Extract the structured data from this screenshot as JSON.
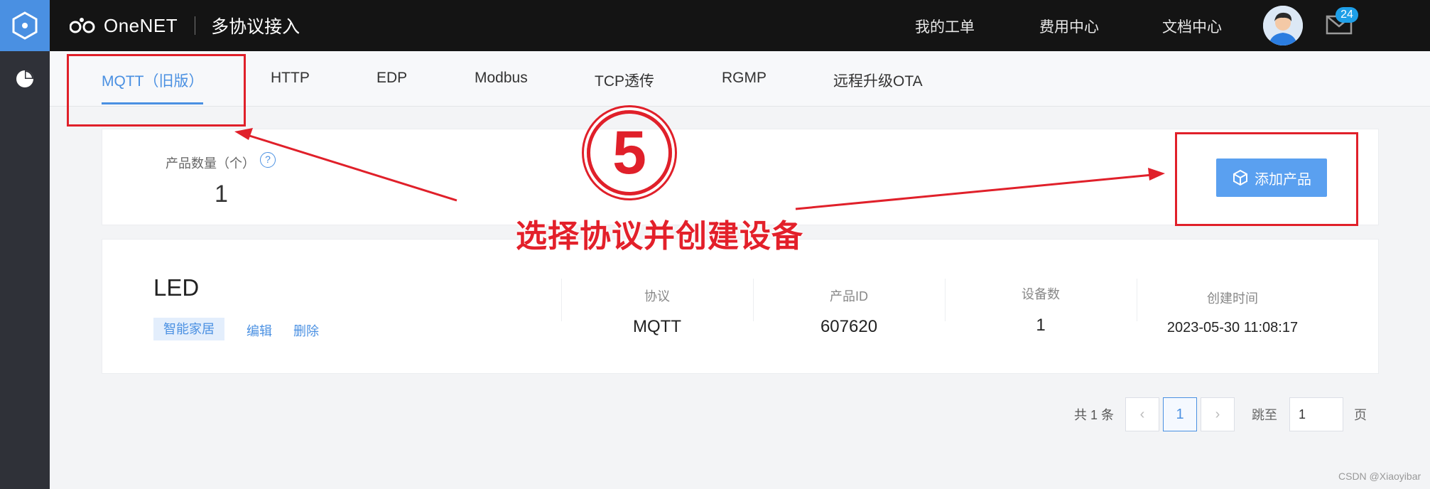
{
  "header": {
    "brand_name": "OneNET",
    "section_title": "多协议接入",
    "nav": [
      "我的工单",
      "费用中心",
      "文档中心"
    ],
    "notification_count": "24"
  },
  "tabs": [
    "MQTT（旧版）",
    "HTTP",
    "EDP",
    "Modbus",
    "TCP透传",
    "RGMP",
    "远程升级OTA"
  ],
  "active_tab": "MQTT（旧版）",
  "summary": {
    "label": "产品数量（个）",
    "help": "?",
    "value": "1",
    "add_button": "添加产品"
  },
  "product": {
    "name": "LED",
    "tag": "智能家居",
    "edit": "编辑",
    "delete": "删除",
    "columns": [
      {
        "head": "协议",
        "value": "MQTT"
      },
      {
        "head": "产品ID",
        "value": "607620"
      },
      {
        "head": "设备数",
        "value": "1"
      },
      {
        "head": "创建时间",
        "value": "2023-05-30 11:08:17"
      }
    ]
  },
  "pagination": {
    "total": "共 1 条",
    "prev": "‹",
    "current": "1",
    "next": "›",
    "jump_label": "跳至",
    "jump_value": "1",
    "page_suffix": "页"
  },
  "annotation": {
    "step": "5",
    "text": "选择协议并创建设备",
    "color": "#e0202a"
  },
  "watermark": "CSDN @Xiaoyibar",
  "colors": {
    "accent": "#4a90e2",
    "topbar": "#141414",
    "sidebar": "#2f3138"
  }
}
